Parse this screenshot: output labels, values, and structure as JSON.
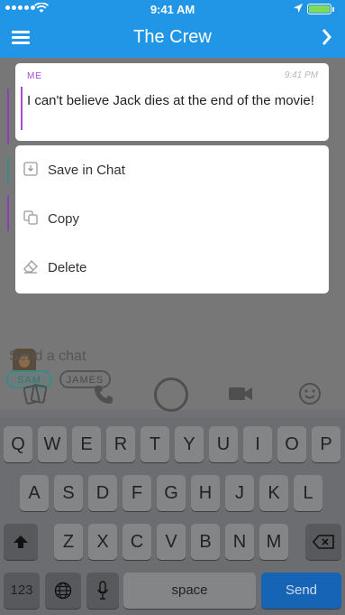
{
  "status": {
    "time": "9:41 AM"
  },
  "nav": {
    "title": "The Crew"
  },
  "bubble": {
    "sender": "ME",
    "time": "9:41 PM",
    "message": "I can't believe Jack dies at the end of the movie!"
  },
  "menu": [
    {
      "label": "Save in Chat",
      "icon": "save-icon"
    },
    {
      "label": "Copy",
      "icon": "copy-icon"
    },
    {
      "label": "Delete",
      "icon": "eraser-icon"
    }
  ],
  "chips": [
    "SAM",
    "JAMES"
  ],
  "compose": {
    "placeholder": "Send a chat"
  },
  "keyboard": {
    "row1": [
      "Q",
      "W",
      "E",
      "R",
      "T",
      "Y",
      "U",
      "I",
      "O",
      "P"
    ],
    "row2": [
      "A",
      "S",
      "D",
      "F",
      "G",
      "H",
      "J",
      "K",
      "L"
    ],
    "row3": [
      "Z",
      "X",
      "C",
      "V",
      "B",
      "N",
      "M"
    ],
    "numbers": "123",
    "space": "space",
    "send": "Send"
  },
  "colors": {
    "accent": "#2196E6",
    "me": "#A44AD0",
    "sam": "#2C7872"
  }
}
